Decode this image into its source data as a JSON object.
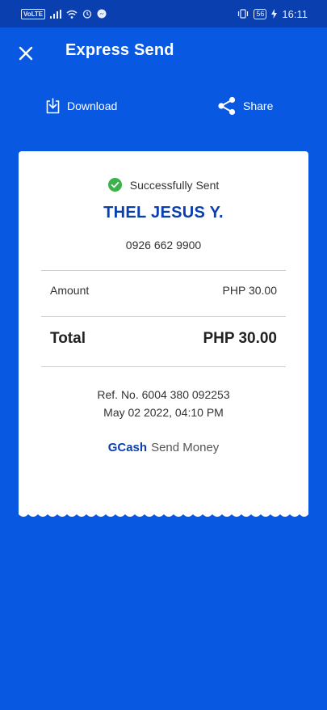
{
  "status_bar": {
    "volte": "VoLTE",
    "battery": "56",
    "time": "16:11"
  },
  "header": {
    "title": "Express Send"
  },
  "actions": {
    "download_label": "Download",
    "share_label": "Share"
  },
  "receipt": {
    "status_text": "Successfully Sent",
    "recipient_name": "THEL JESUS Y.",
    "recipient_phone": "0926 662 9900",
    "amount_label": "Amount",
    "amount_value": "PHP 30.00",
    "total_label": "Total",
    "total_value": "PHP 30.00",
    "ref_line": "Ref. No. 6004 380 092253",
    "date_line": "May 02 2022, 04:10 PM",
    "brand_logo": "GCash",
    "brand_text": "Send Money"
  },
  "colors": {
    "background": "#0958e2",
    "status_bar": "#0a3fb0",
    "accent_name": "#0a3fb0",
    "success": "#3bb24a"
  },
  "icons": {
    "close": "close-icon",
    "download": "download-icon",
    "share": "share-icon",
    "success": "check-circle-icon"
  }
}
